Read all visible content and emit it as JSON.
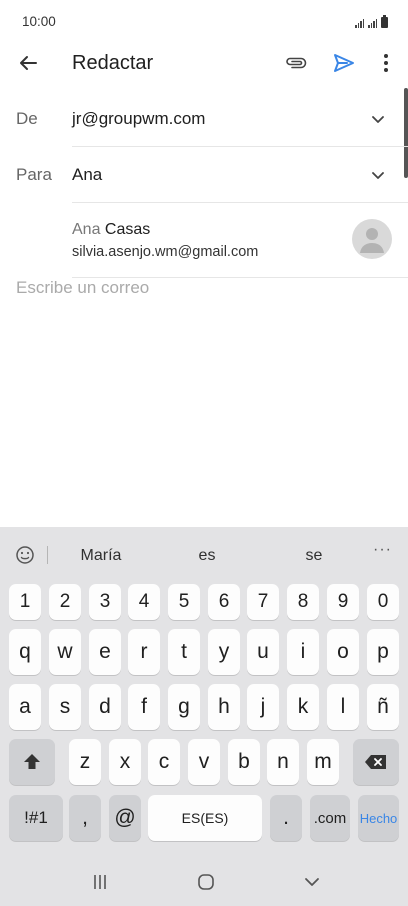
{
  "status": {
    "time": "10:00"
  },
  "toolbar": {
    "title": "Redactar"
  },
  "from": {
    "label": "De",
    "value": "jr@groupwm.com"
  },
  "to": {
    "label": "Para",
    "value": "Ana"
  },
  "suggestion": {
    "name_match": "Ana",
    "name_rest": " Casas",
    "email": "silvia.asenjo.wm@gmail.com"
  },
  "body": {
    "placeholder": "Escribe un correo"
  },
  "keyboard": {
    "suggestions": [
      "María",
      "es",
      "se"
    ],
    "more": "···",
    "row_numbers": [
      "1",
      "2",
      "3",
      "4",
      "5",
      "6",
      "7",
      "8",
      "9",
      "0"
    ],
    "row1": [
      "q",
      "w",
      "e",
      "r",
      "t",
      "y",
      "u",
      "i",
      "o",
      "p"
    ],
    "row2": [
      "a",
      "s",
      "d",
      "f",
      "g",
      "h",
      "j",
      "k",
      "l",
      "ñ"
    ],
    "row3": [
      "z",
      "x",
      "c",
      "v",
      "b",
      "n",
      "m"
    ],
    "symbols": "!#1",
    "comma": ",",
    "at": "@",
    "space": "ES(ES)",
    "period": ".",
    "com": ".com",
    "done": "Hecho"
  },
  "colors": {
    "accent": "#3a86e6",
    "keyboard_bg": "#e3e3e5"
  }
}
